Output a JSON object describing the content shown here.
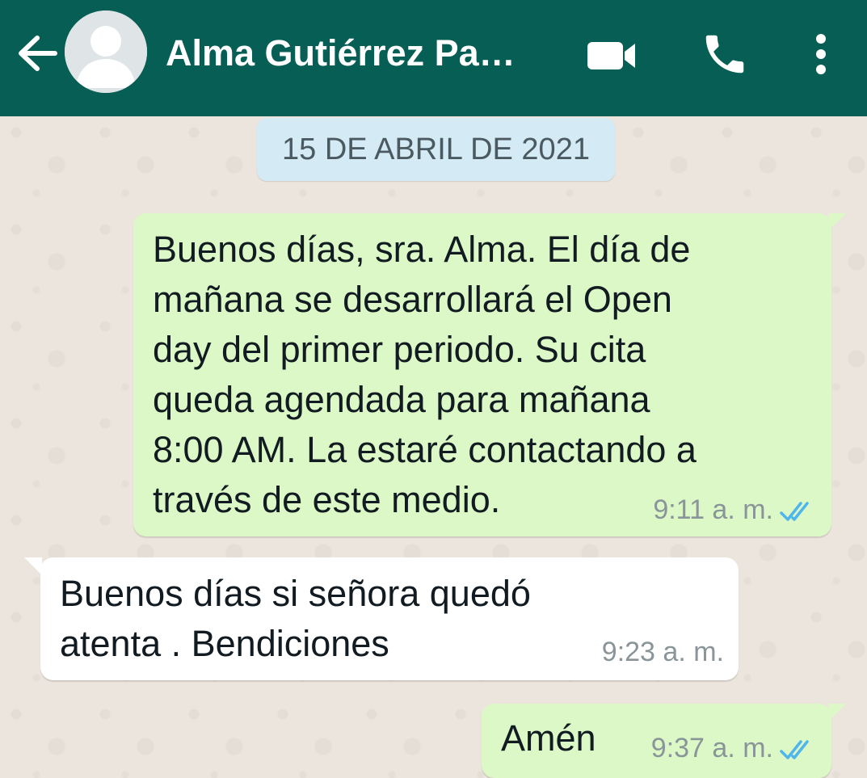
{
  "header": {
    "contact_name": "Alma Gutiérrez Pa…",
    "background_color": "#075E54",
    "icons": {
      "back": "arrow-left-icon",
      "avatar": "default-avatar-icon",
      "video": "video-camera-icon",
      "call": "phone-icon",
      "menu": "more-vertical-icon"
    }
  },
  "chat": {
    "date_separator": "15 DE ABRIL DE 2021",
    "messages": [
      {
        "direction": "outgoing",
        "lines": [
          "Buenos días, sra. Alma. El día de",
          "mañana se desarrollará el Open",
          "day del primer periodo. Su cita",
          "queda agendada para mañana",
          "8:00 AM. La estaré contactando a",
          "través de este medio."
        ],
        "time": "9:11 a. m.",
        "status": "read-double-check-icon"
      },
      {
        "direction": "incoming",
        "lines": [
          "Buenos días si señora quedó",
          "atenta . Bendiciones"
        ],
        "time": "9:23 a. m."
      },
      {
        "direction": "outgoing",
        "lines": [
          "Amén"
        ],
        "time": "9:37 a. m.",
        "status": "read-double-check-icon"
      }
    ]
  },
  "colors": {
    "outgoing_bubble": "#DCF8C6",
    "incoming_bubble": "#FFFFFF",
    "date_chip": "#D4EAF4",
    "read_ticks": "#4FB6EC",
    "wallpaper": "#ECE5DD"
  }
}
